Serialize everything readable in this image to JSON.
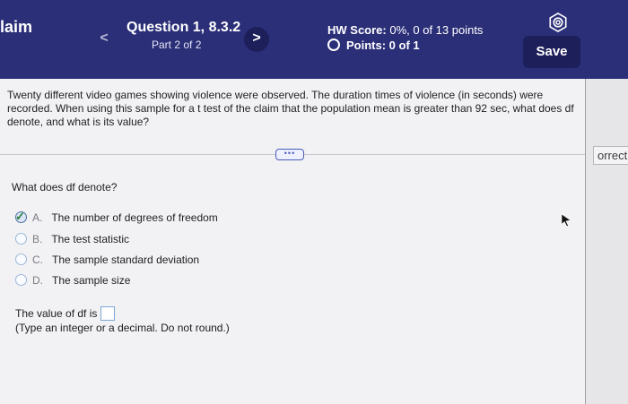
{
  "header": {
    "left_title": "laim",
    "prev_label": "<",
    "next_label": ">",
    "question_title": "Question 1, 8.3.2",
    "question_part": "Part 2 of 2",
    "hw_score_label": "HW Score:",
    "hw_score_value": "0%, 0 of 13 points",
    "points_label": "Points: 0 of 1",
    "save_label": "Save",
    "gear_icon": "gear-icon",
    "colors": {
      "bar": "#2b2f78",
      "button": "#1d1f5a"
    }
  },
  "question": {
    "text": "Twenty different video games showing violence were observed. The duration times of violence (in seconds) were recorded. When using this sample for a t test of the claim that the population mean is greater than 92 sec, what does df denote, and what is its value?"
  },
  "divider_handle_label": "•••",
  "side_label": "orrect",
  "subquestion": "What does df denote?",
  "options": [
    {
      "letter": "A.",
      "text": "The number of degrees of freedom",
      "selected": true
    },
    {
      "letter": "B.",
      "text": "The test statistic",
      "selected": false
    },
    {
      "letter": "C.",
      "text": "The sample standard deviation",
      "selected": false
    },
    {
      "letter": "D.",
      "text": "The sample size",
      "selected": false
    }
  ],
  "value_prompt": "The value of df is",
  "instruction": "(Type an integer or a decimal. Do not round.)"
}
